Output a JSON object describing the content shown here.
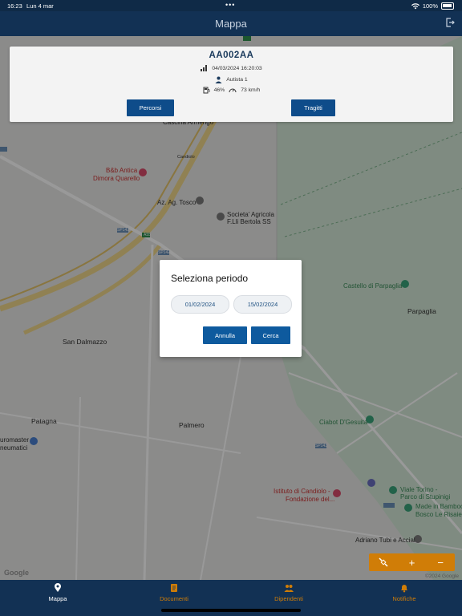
{
  "status_bar": {
    "time": "16:23",
    "date": "Lun 4 mar",
    "battery": "100%"
  },
  "nav": {
    "title": "Mappa",
    "logout_icon": "logout-icon"
  },
  "vehicle_card": {
    "plate": "AA002AA",
    "timestamp": "04/03/2024 16:20:03",
    "driver": "Autista 1",
    "fuel": "46%",
    "speed": "73 km/h",
    "buttons": {
      "percorsi": "Percorsi",
      "tragitti": "Tragitti"
    }
  },
  "map": {
    "labels": {
      "castello": "Castello di Parpaglia",
      "parpaglia": "Parpaglia",
      "san_dalmazzo": "San Dalmazzo",
      "patagna": "Patagna",
      "palmero": "Palmero",
      "bnb1": "B&b Antica",
      "bnb2": "Dimora Quarello",
      "agtosco": "Az. Ag. Tosco",
      "societa1": "Societa' Agricola",
      "societa2": "F.Lli Bertola SS",
      "ciabot": "Ciabot D'Gesuita",
      "istituto1": "Istituto di Candiolo -",
      "istituto2": "Fondazione del...",
      "viale1": "Viale Torino -",
      "viale2": "Parco di Stupinigi",
      "made1": "Made in Bamboo",
      "made2": "Bosco Le Risaie",
      "adriano": "Adriano Tubi e Accial",
      "euromaster1": "uromaster",
      "euromaster2": "neumatici",
      "cascina": "Cascina Armengo",
      "road_sp143a": "SP143",
      "road_sp142": "SP142",
      "road_a55": "A55",
      "road_candiolo": "Candiolo",
      "road_sp143b": "SP143"
    },
    "google": "Google",
    "copyright": "©2024 Google",
    "controls": {
      "layers_icon": "satellite-icon",
      "zoom_in": "+",
      "zoom_out": "−"
    }
  },
  "dialog": {
    "title": "Seleziona periodo",
    "date_from": "01/02/2024",
    "date_to": "15/02/2024",
    "cancel": "Annulla",
    "search": "Cerca"
  },
  "tabs": [
    {
      "label": "Mappa",
      "icon": "map-pin-icon",
      "active": true
    },
    {
      "label": "Documenti",
      "icon": "document-icon",
      "active": false
    },
    {
      "label": "Dipendenti",
      "icon": "people-icon",
      "active": false
    },
    {
      "label": "Notifiche",
      "icon": "bell-icon",
      "active": false
    }
  ],
  "colors": {
    "primary": "#123154",
    "button": "#0e5a9e",
    "accent": "#d07d07",
    "tab_active": "#ffffff",
    "tab_inactive": "#d07d07"
  }
}
